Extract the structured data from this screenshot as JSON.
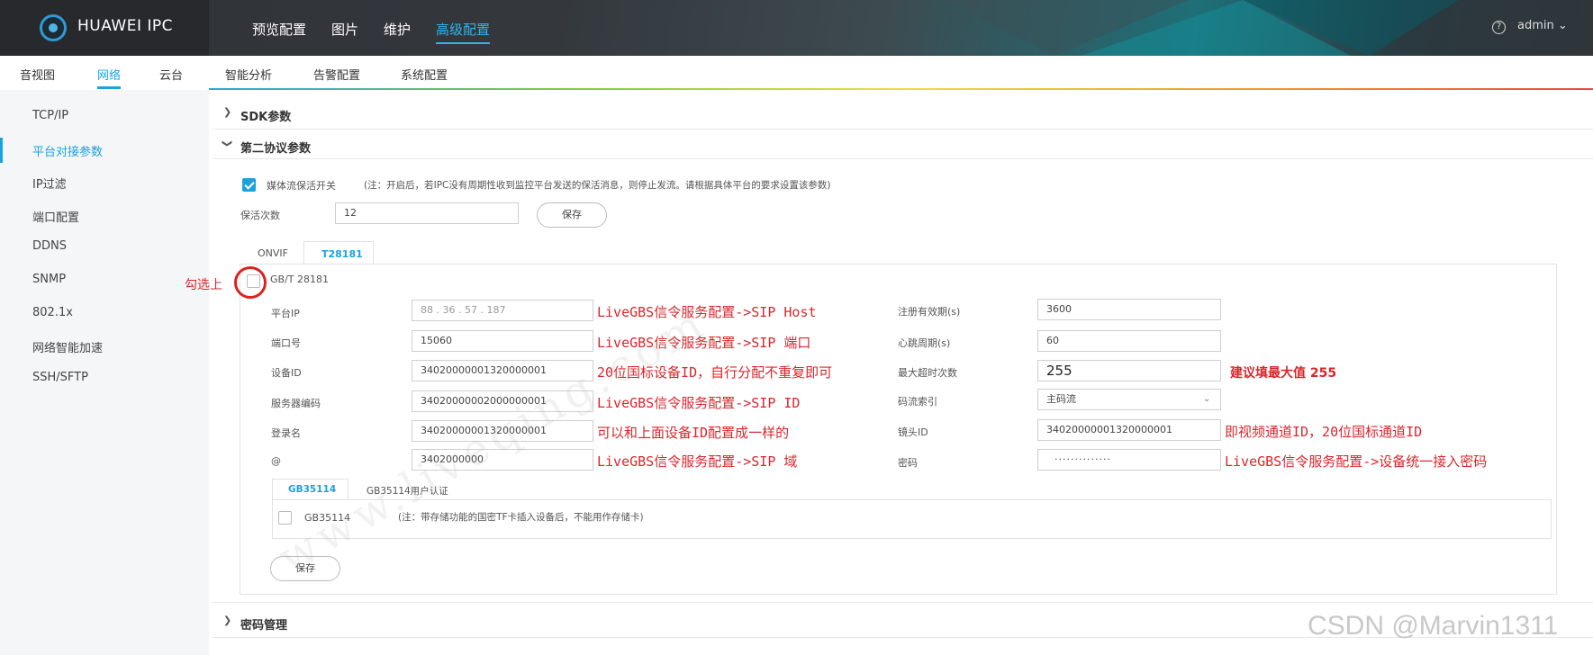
{
  "header": {
    "logo_text": "HUAWEI IPC",
    "nav": [
      "预览配置",
      "图片",
      "维护",
      "高级配置"
    ],
    "active_nav_index": 3,
    "user": "admin ⌄",
    "help_icon": "?"
  },
  "subnav": {
    "items": [
      "音视图",
      "网络",
      "云台",
      "智能分析",
      "告警配置",
      "系统配置"
    ],
    "active_index": 1
  },
  "sidebar": {
    "items": [
      "TCP/IP",
      "平台对接参数",
      "IP过滤",
      "端口配置",
      "DDNS",
      "SNMP",
      "802.1x",
      "网络智能加速",
      "SSH/SFTP"
    ],
    "active_index": 1
  },
  "sections": {
    "sdk": "SDK参数",
    "second_protocol": "第二协议参数",
    "password_mgmt": "密码管理"
  },
  "keepalive": {
    "checkbox_label": "媒体流保活开关",
    "checked": true,
    "note": "(注：开启后，若IPC没有周期性收到监控平台发送的保活消息，则停止发流。请根据具体平台的要求设置该参数)",
    "count_label": "保活次数",
    "count_value": "12",
    "save_label": "保存"
  },
  "protocol_tabs": [
    "ONVIF",
    "T28181"
  ],
  "protocol_active_index": 1,
  "gbt": {
    "checkbox_label": "GB/T 28181",
    "checked": false,
    "left": [
      {
        "label": "平台IP",
        "value": "88 . 36 . 57 . 187"
      },
      {
        "label": "端口号",
        "value": "15060"
      },
      {
        "label": "设备ID",
        "value": "34020000001320000001"
      },
      {
        "label": "服务器编码",
        "value": "34020000002000000001"
      },
      {
        "label": "登录名",
        "value": "34020000001320000001"
      },
      {
        "label": "@",
        "value": "3402000000"
      }
    ],
    "right": [
      {
        "label": "注册有效期(s)",
        "value": "3600"
      },
      {
        "label": "心跳周期(s)",
        "value": "60"
      },
      {
        "label": "最大超时次数",
        "value": "255"
      },
      {
        "label": "码流索引",
        "value": "主码流"
      },
      {
        "label": "镜头ID",
        "value": "34020000001320000001"
      },
      {
        "label": "密码",
        "value": "··············"
      }
    ]
  },
  "gb35114": {
    "tabs": [
      "GB35114",
      "GB35114用户认证"
    ],
    "active_index": 0,
    "checkbox_label": "GB35114",
    "checked": false,
    "note": "(注：带存储功能的国密TF卡插入设备后，不能用作存储卡)"
  },
  "save_button": "保存",
  "annotations": {
    "check_hint": "勾选上",
    "sip_host": "LiveGBS信令服务配置->SIP Host",
    "sip_port": "LiveGBS信令服务配置->SIP 端口",
    "device_id": "20位国标设备ID，自行分配不重复即可",
    "sip_id": "LiveGBS信令服务配置->SIP ID",
    "login_name": "可以和上面设备ID配置成一样的",
    "sip_domain": "LiveGBS信令服务配置->SIP 域",
    "max_timeout": "建议填最大值 255",
    "channel_id": "即视频通道ID，20位国标通道ID",
    "password": "LiveGBS信令服务配置->设备统一接入密码"
  },
  "watermarks": {
    "diagonal": "www.liveqing.com",
    "csdn": "CSDN @Marvin1311"
  },
  "colors": {
    "accent": "#1aa3dd",
    "annotation_red": "#d8272c",
    "topbar": "#2f3338"
  }
}
